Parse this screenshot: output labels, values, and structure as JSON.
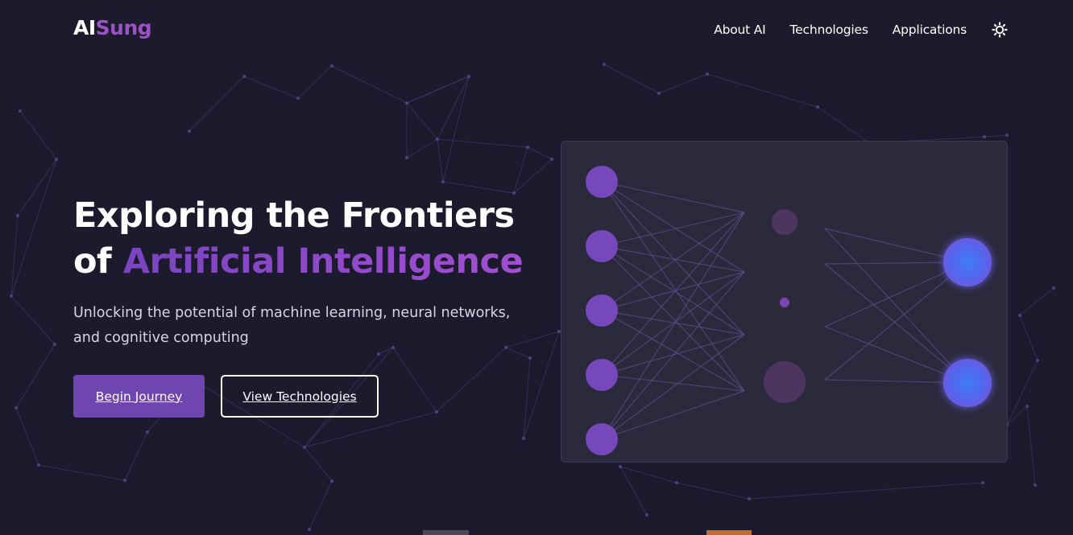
{
  "brand": {
    "prefix": "AI",
    "suffix": "Sung"
  },
  "nav": {
    "items": [
      {
        "label": "About AI"
      },
      {
        "label": "Technologies"
      },
      {
        "label": "Applications"
      }
    ],
    "theme_toggle_icon": "sun-icon"
  },
  "hero": {
    "title_line1": "Exploring the Frontiers",
    "title_line2_prefix": "of ",
    "title_line2_accent": "Artificial Intelligence",
    "subtitle": "Unlocking the potential of machine learning, neural networks, and cognitive computing",
    "primary_button": "Begin Journey",
    "secondary_button": "View Technologies"
  },
  "neural_network": {
    "layers": [
      5,
      3,
      2
    ]
  },
  "colors": {
    "background": "#1c1a2d",
    "accent": "#8a4fc4",
    "primary_button": "#6f46b0",
    "node_input": "#7a4ac2",
    "node_hidden": "#4e3560",
    "node_output": "#4f6df0"
  }
}
